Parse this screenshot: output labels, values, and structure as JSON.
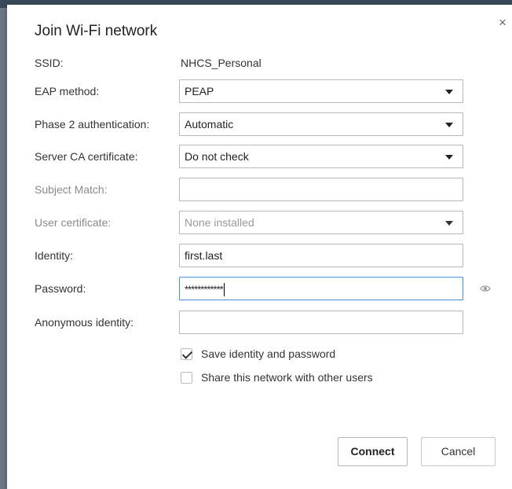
{
  "dialog": {
    "title": "Join Wi-Fi network",
    "close_glyph": "×"
  },
  "fields": {
    "ssid": {
      "label": "SSID:",
      "value": "NHCS_Personal"
    },
    "eap_method": {
      "label": "EAP method:",
      "value": "PEAP"
    },
    "phase2": {
      "label": "Phase 2 authentication:",
      "value": "Automatic"
    },
    "server_ca": {
      "label": "Server CA certificate:",
      "value": "Do not check"
    },
    "subject_match": {
      "label": "Subject Match:",
      "value": ""
    },
    "user_cert": {
      "label": "User certificate:",
      "value": "None installed"
    },
    "identity": {
      "label": "Identity:",
      "value": "first.last"
    },
    "password": {
      "label": "Password:",
      "value": "************"
    },
    "anon_identity": {
      "label": "Anonymous identity:",
      "value": ""
    }
  },
  "checkboxes": {
    "save_identity": {
      "label": "Save identity and password",
      "checked": true
    },
    "share_network": {
      "label": "Share this network with other users",
      "checked": false
    }
  },
  "buttons": {
    "connect": "Connect",
    "cancel": "Cancel"
  },
  "icons": {
    "close": "close-icon",
    "show_password": "eye-icon",
    "dropdown": "chevron-down-icon"
  }
}
